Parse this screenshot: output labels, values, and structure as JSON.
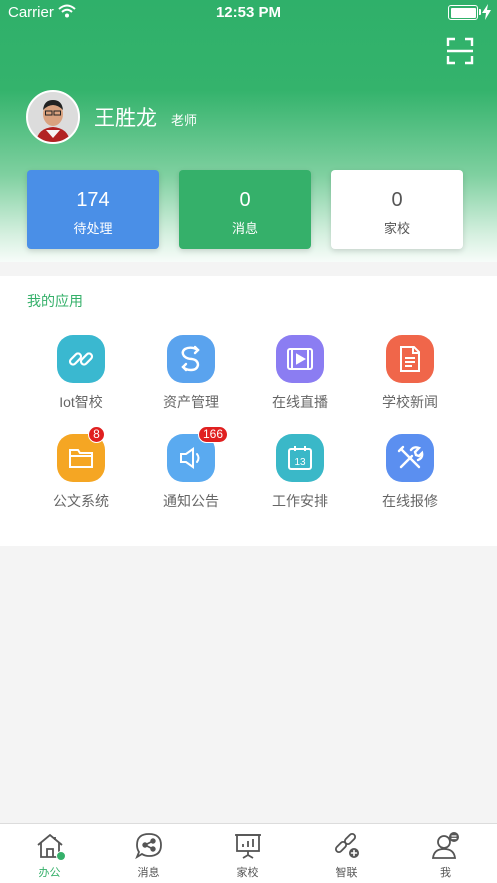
{
  "status_bar": {
    "carrier": "Carrier",
    "time": "12:53 PM"
  },
  "profile": {
    "name": "王胜龙",
    "role": "老师"
  },
  "stats": [
    {
      "value": "174",
      "label": "待处理"
    },
    {
      "value": "0",
      "label": "消息"
    },
    {
      "value": "0",
      "label": "家校"
    }
  ],
  "apps": {
    "title": "我的应用",
    "items": [
      {
        "label": "Iot智校",
        "icon": "link-icon",
        "color": "#3ab8d0"
      },
      {
        "label": "资产管理",
        "icon": "asset-icon",
        "color": "#5aa3ee"
      },
      {
        "label": "在线直播",
        "icon": "video-icon",
        "color": "#8b7df2"
      },
      {
        "label": "学校新闻",
        "icon": "news-icon",
        "color": "#f0664a"
      },
      {
        "label": "公文系统",
        "icon": "folder-icon",
        "color": "#f5a623",
        "badge": "8"
      },
      {
        "label": "通知公告",
        "icon": "speaker-icon",
        "color": "#5aaaf0",
        "badge": "166"
      },
      {
        "label": "工作安排",
        "icon": "calendar-icon",
        "color": "#3ab8c8"
      },
      {
        "label": "在线报修",
        "icon": "tools-icon",
        "color": "#5b8ff0"
      }
    ]
  },
  "tabs": [
    {
      "label": "办公",
      "icon": "home-icon",
      "active": true
    },
    {
      "label": "消息",
      "icon": "chat-share-icon"
    },
    {
      "label": "家校",
      "icon": "chart-board-icon"
    },
    {
      "label": "智联",
      "icon": "link-plus-icon"
    },
    {
      "label": "我",
      "icon": "user-icon"
    }
  ]
}
